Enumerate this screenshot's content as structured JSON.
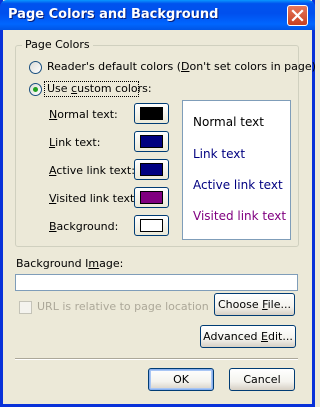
{
  "window": {
    "title": "Page Colors and Background"
  },
  "page_colors": {
    "group_label": "Page Colors",
    "radio_default": {
      "label_pre": "Reader's default colors (",
      "label_key": "D",
      "label_post": "on't set colors in page)",
      "checked": false
    },
    "radio_custom": {
      "label_pre": "Use ",
      "label_key": "c",
      "label_post": "ustom colors:",
      "checked": true
    },
    "rows": [
      {
        "key": "N",
        "rest": "ormal text:",
        "color": "#000000"
      },
      {
        "key": "L",
        "rest": "ink text:",
        "color": "#000080"
      },
      {
        "key": "A",
        "rest": "ctive link text:",
        "color": "#000080"
      },
      {
        "key": "V",
        "rest": "isited link text:",
        "color": "#800080"
      },
      {
        "key": "B",
        "rest": "ackground:",
        "color": "#ffffff"
      }
    ],
    "preview": {
      "normal": "Normal text",
      "link": "Link text",
      "active": "Active link text",
      "visited": "Visited link text",
      "normal_color": "#000000",
      "link_color": "#000080",
      "active_color": "#000080",
      "visited_color": "#800080"
    }
  },
  "background_image": {
    "label_pre": "Background I",
    "label_key": "m",
    "label_post": "age:",
    "value": "",
    "relative_checkbox_label": "URL is relative to page location",
    "relative_checked": false,
    "relative_disabled": true,
    "choose_file_pre": "Choose ",
    "choose_file_key": "F",
    "choose_file_post": "ile...",
    "advanced_pre": "Advanced ",
    "advanced_key": "E",
    "advanced_post": "dit..."
  },
  "buttons": {
    "ok": "OK",
    "cancel": "Cancel"
  },
  "icons": {
    "close": "close-icon"
  }
}
